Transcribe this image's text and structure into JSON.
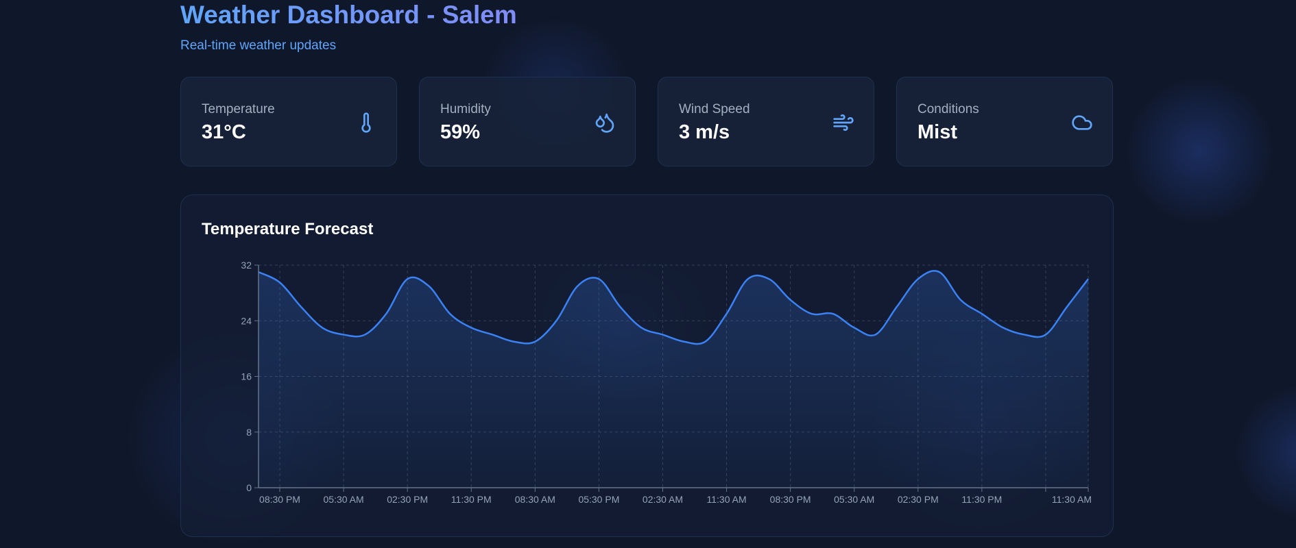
{
  "header": {
    "title": "Weather Dashboard - Salem",
    "subtitle": "Real-time weather updates"
  },
  "cards": [
    {
      "label": "Temperature",
      "value": "31°C",
      "icon": "thermometer-icon"
    },
    {
      "label": "Humidity",
      "value": "59%",
      "icon": "droplets-icon"
    },
    {
      "label": "Wind Speed",
      "value": "3 m/s",
      "icon": "wind-icon"
    },
    {
      "label": "Conditions",
      "value": "Mist",
      "icon": "cloud-icon"
    }
  ],
  "colors": {
    "accent": "#60a5fa",
    "line": "#3b82f6",
    "background": "#0f172a"
  },
  "chart_data": {
    "type": "area",
    "title": "Temperature Forecast",
    "ylim": [
      0,
      32
    ],
    "yticks": [
      0,
      8,
      16,
      24,
      32
    ],
    "xtick_labels": [
      "08:30 PM",
      "05:30 AM",
      "02:30 PM",
      "11:30 PM",
      "08:30 AM",
      "05:30 PM",
      "02:30 AM",
      "11:30 AM",
      "08:30 PM",
      "05:30 AM",
      "02:30 PM",
      "11:30 PM",
      "11:30 AM"
    ],
    "grid": true,
    "x": [
      "05:30 PM",
      "08:30 PM",
      "11:30 PM",
      "02:30 AM",
      "05:30 AM",
      "08:30 AM",
      "11:30 AM",
      "02:30 PM",
      "05:30 PM",
      "08:30 PM",
      "11:30 PM",
      "02:30 AM",
      "05:30 AM",
      "08:30 AM",
      "11:30 AM",
      "02:30 PM",
      "05:30 PM",
      "08:30 PM",
      "11:30 PM",
      "02:30 AM",
      "05:30 AM",
      "08:30 AM",
      "11:30 AM",
      "02:30 PM",
      "05:30 PM",
      "08:30 PM",
      "11:30 PM",
      "02:30 AM",
      "05:30 AM",
      "08:30 AM",
      "11:30 AM",
      "02:30 PM",
      "05:30 PM",
      "08:30 PM",
      "11:30 PM",
      "02:30 AM",
      "05:30 AM",
      "08:30 AM",
      "11:30 AM",
      "02:30 PM",
      "05:30 PM",
      "08:30 PM",
      "11:30 PM",
      "02:30 AM",
      "05:30 AM",
      "08:30 AM",
      "11:30 AM"
    ],
    "values": [
      31,
      29.5,
      26,
      23,
      22,
      22,
      25,
      30,
      29,
      25,
      23,
      22,
      21,
      21,
      24,
      29,
      30,
      26,
      23,
      22,
      21,
      21,
      25,
      30,
      30,
      27,
      25,
      25,
      23,
      22,
      26,
      30,
      31,
      27,
      25,
      23,
      22,
      22,
      26,
      30
    ]
  }
}
